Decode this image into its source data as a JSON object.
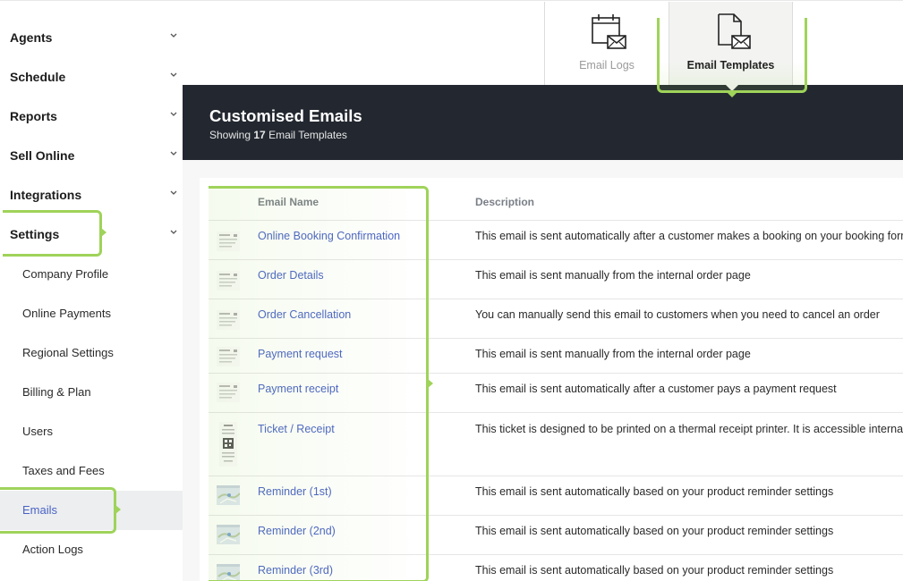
{
  "sidebar": {
    "sections": [
      {
        "label": "Agents"
      },
      {
        "label": "Schedule"
      },
      {
        "label": "Reports"
      },
      {
        "label": "Sell Online"
      },
      {
        "label": "Integrations"
      },
      {
        "label": "Settings"
      }
    ],
    "settings_items": [
      {
        "label": "Company Profile"
      },
      {
        "label": "Online Payments"
      },
      {
        "label": "Regional Settings"
      },
      {
        "label": "Billing & Plan"
      },
      {
        "label": "Users"
      },
      {
        "label": "Taxes and Fees"
      },
      {
        "label": "Emails",
        "active": true
      },
      {
        "label": "Action Logs"
      }
    ]
  },
  "tabs": {
    "logs_label": "Email Logs",
    "templates_label": "Email Templates",
    "active": "Email Templates",
    "icons": {
      "logs": "calendar-mail-icon",
      "templates": "document-mail-icon"
    }
  },
  "header": {
    "title": "Customised Emails",
    "subtitle_prefix": "Showing",
    "count": "17",
    "subtitle_suffix": "Email Templates"
  },
  "table": {
    "columns": {
      "name": "Email Name",
      "description": "Description"
    },
    "rows": [
      {
        "name": "Online Booking Confirmation",
        "description": "This email is sent automatically after a customer makes a booking on your booking form",
        "thumb": "email-thumbnail"
      },
      {
        "name": "Order Details",
        "description": "This email is sent manually from the internal order page",
        "thumb": "email-thumbnail"
      },
      {
        "name": "Order Cancellation",
        "description": "You can manually send this email to customers when you need to cancel an order",
        "thumb": "email-thumbnail"
      },
      {
        "name": "Payment request",
        "description": "This email is sent manually from the internal order page",
        "thumb": "email-thumbnail"
      },
      {
        "name": "Payment receipt",
        "description": "This email is sent automatically after a customer pays a payment request",
        "thumb": "email-thumbnail"
      },
      {
        "name": "Ticket / Receipt",
        "description": "This ticket is designed to be printed on a thermal receipt printer. It is accessible internally f",
        "thumb": "receipt-thumbnail"
      },
      {
        "name": "Reminder (1st)",
        "description": "This email is sent automatically based on your product reminder settings",
        "thumb": "map-thumbnail"
      },
      {
        "name": "Reminder (2nd)",
        "description": "This email is sent automatically based on your product reminder settings",
        "thumb": "map-thumbnail"
      },
      {
        "name": "Reminder (3rd)",
        "description": "This email is sent automatically based on your product reminder settings",
        "thumb": "map-thumbnail"
      }
    ]
  },
  "colors": {
    "accent_link": "#4a63c5",
    "header_bg": "#232830",
    "highlight": "#9fd35a"
  }
}
